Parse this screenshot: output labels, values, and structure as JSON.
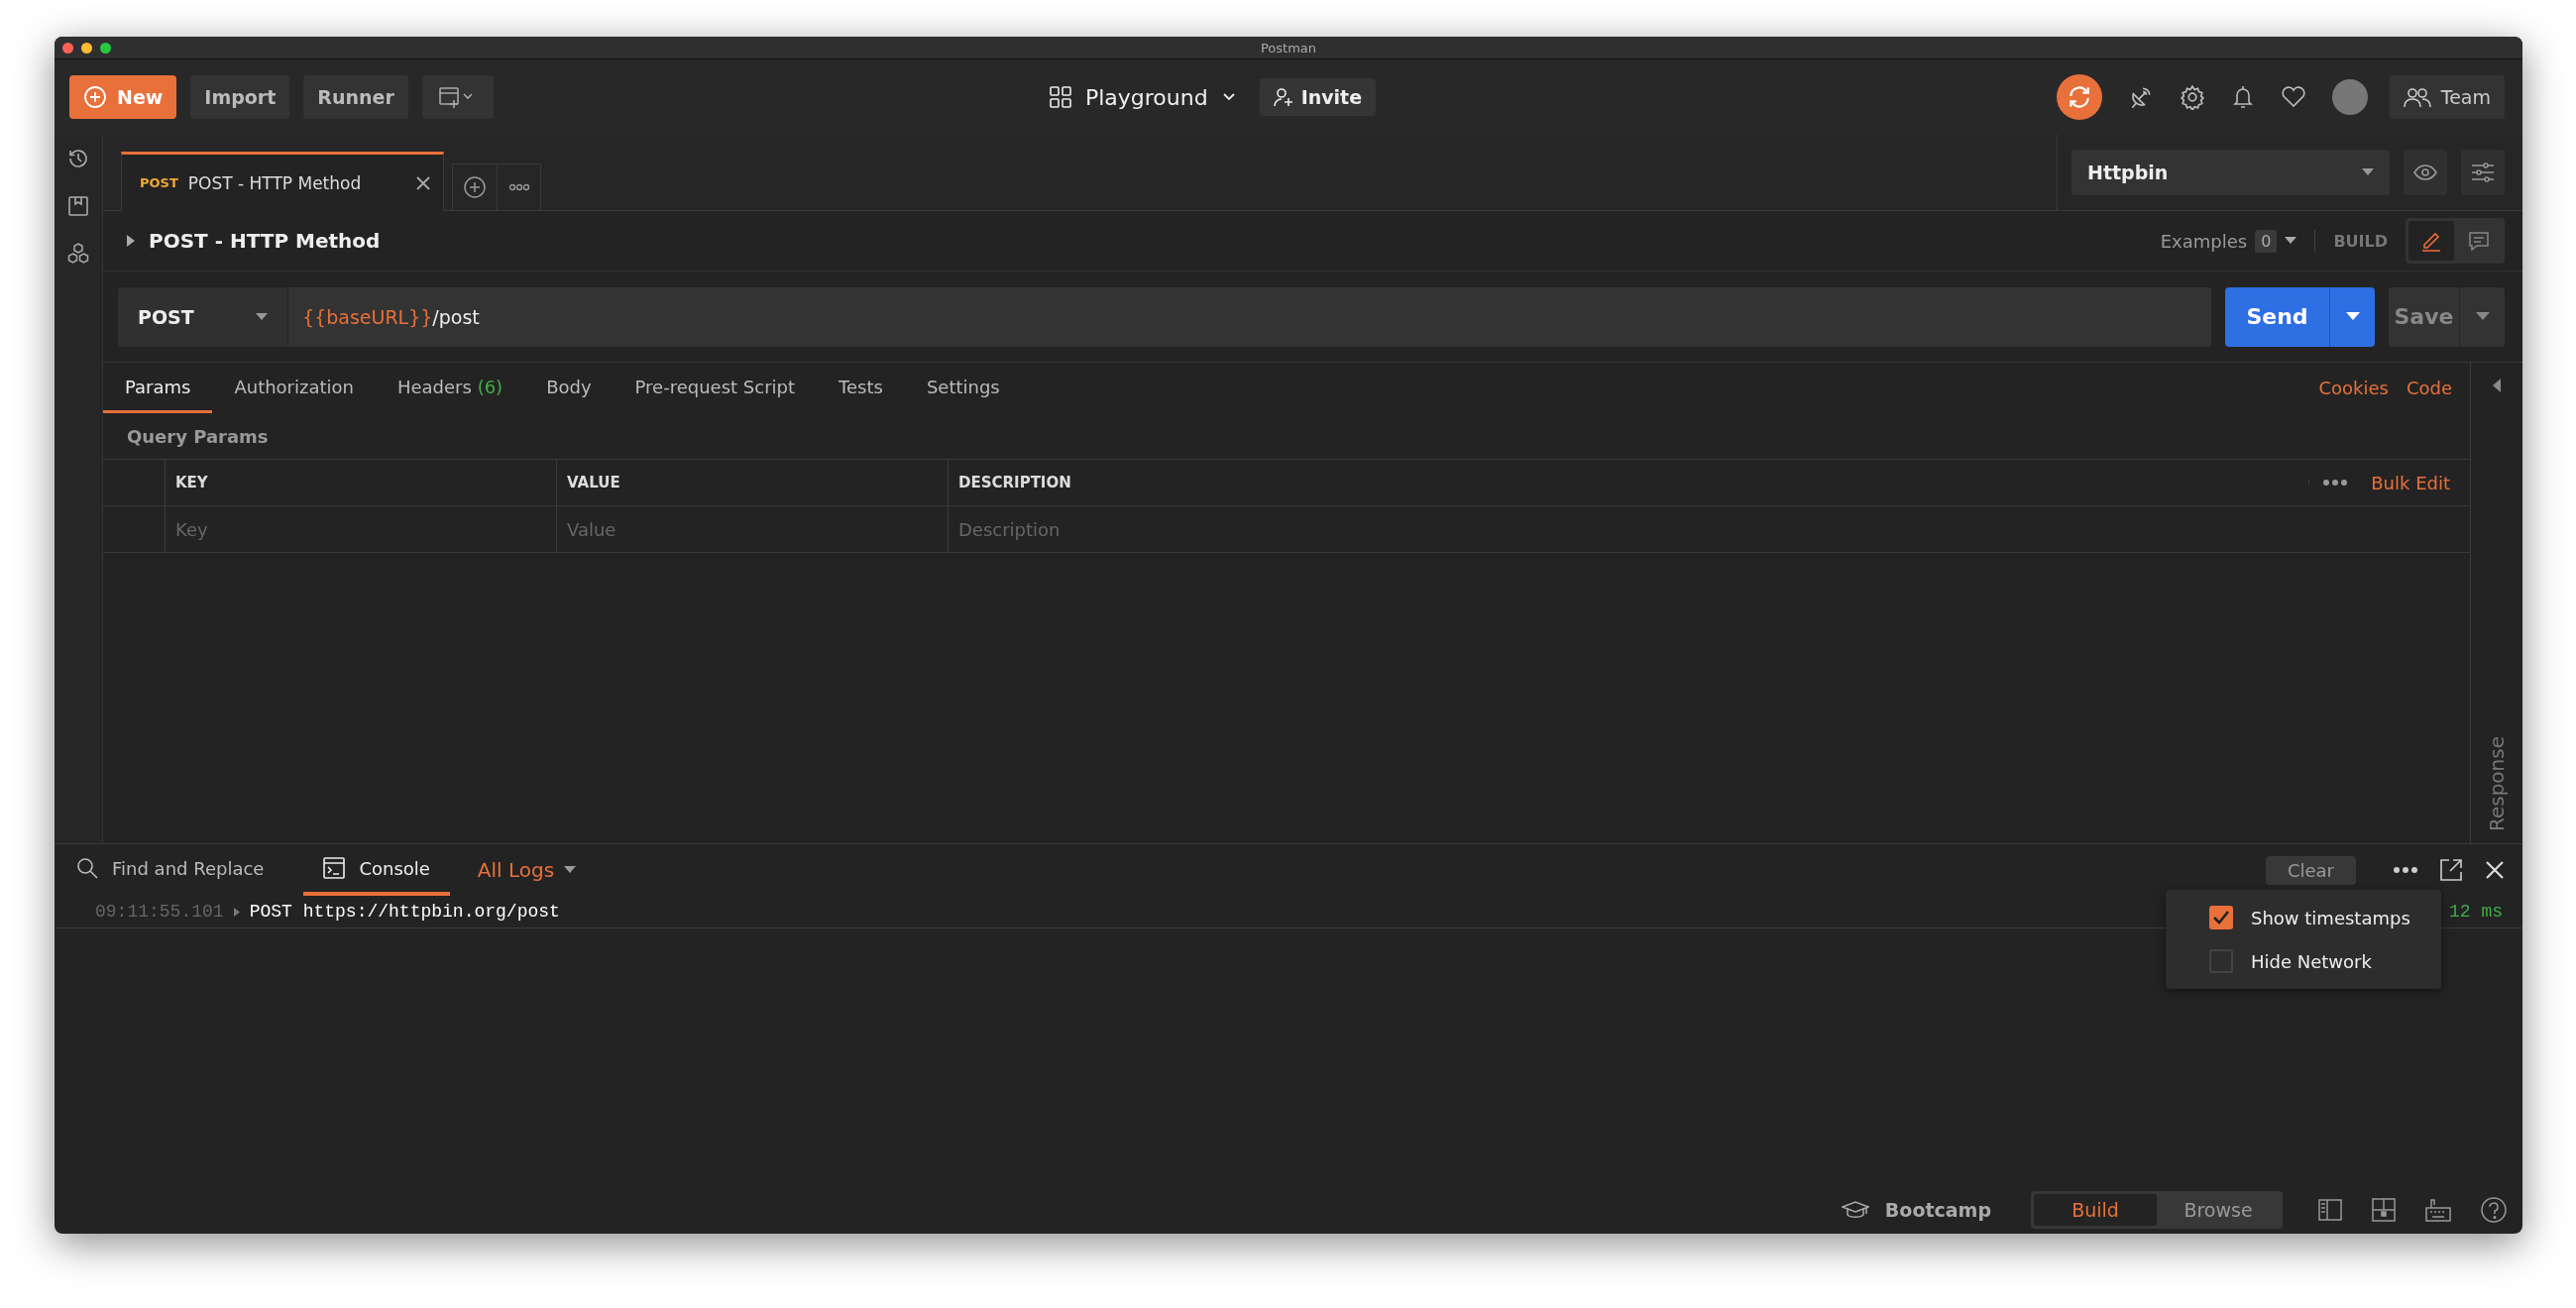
{
  "window": {
    "title": "Postman"
  },
  "header": {
    "new_button": "New",
    "import_button": "Import",
    "runner_button": "Runner",
    "workspace": "Playground",
    "invite_button": "Invite",
    "team_button": "Team"
  },
  "request_tabs": [
    {
      "method": "POST",
      "title": "POST - HTTP Method",
      "selected": true
    }
  ],
  "environment": {
    "name": "Httpbin"
  },
  "request": {
    "name": "POST - HTTP Method",
    "examples_label": "Examples",
    "examples_count": "0",
    "mode": "BUILD",
    "method": "POST",
    "url": [
      {
        "text": "{{baseURL}}",
        "kind": "variable"
      },
      {
        "text": "/post",
        "kind": "plain"
      }
    ],
    "send_button": "Send",
    "save_button": "Save"
  },
  "sections": {
    "tabs": [
      {
        "label": "Params",
        "selected": true
      },
      {
        "label": "Authorization",
        "selected": false
      },
      {
        "label": "Headers",
        "count": "(6)",
        "selected": false
      },
      {
        "label": "Body",
        "selected": false
      },
      {
        "label": "Pre-request Script",
        "selected": false
      },
      {
        "label": "Tests",
        "selected": false
      },
      {
        "label": "Settings",
        "selected": false
      }
    ],
    "links": [
      "Cookies",
      "Code"
    ]
  },
  "params": {
    "title": "Query Params",
    "columns": [
      "KEY",
      "VALUE",
      "DESCRIPTION"
    ],
    "bulk_edit": "Bulk Edit",
    "placeholders": [
      "Key",
      "Value",
      "Description"
    ]
  },
  "response_panel": {
    "label": "Response"
  },
  "console": {
    "tabs": [
      {
        "label": "Find and Replace",
        "kind": "search",
        "selected": false
      },
      {
        "label": "Console",
        "kind": "console",
        "selected": true
      }
    ],
    "filter": "All Logs",
    "clear_button": "Clear",
    "logs": [
      {
        "time": "09:11:55.101",
        "text": "POST https://httpbin.org/post",
        "duration": "12 ms"
      }
    ],
    "menu": [
      {
        "label": "Show timestamps",
        "checked": true
      },
      {
        "label": "Hide Network",
        "checked": false
      }
    ]
  },
  "status_bar": {
    "bootcamp": "Bootcamp",
    "modes": [
      {
        "label": "Build",
        "selected": true
      },
      {
        "label": "Browse",
        "selected": false
      }
    ]
  }
}
